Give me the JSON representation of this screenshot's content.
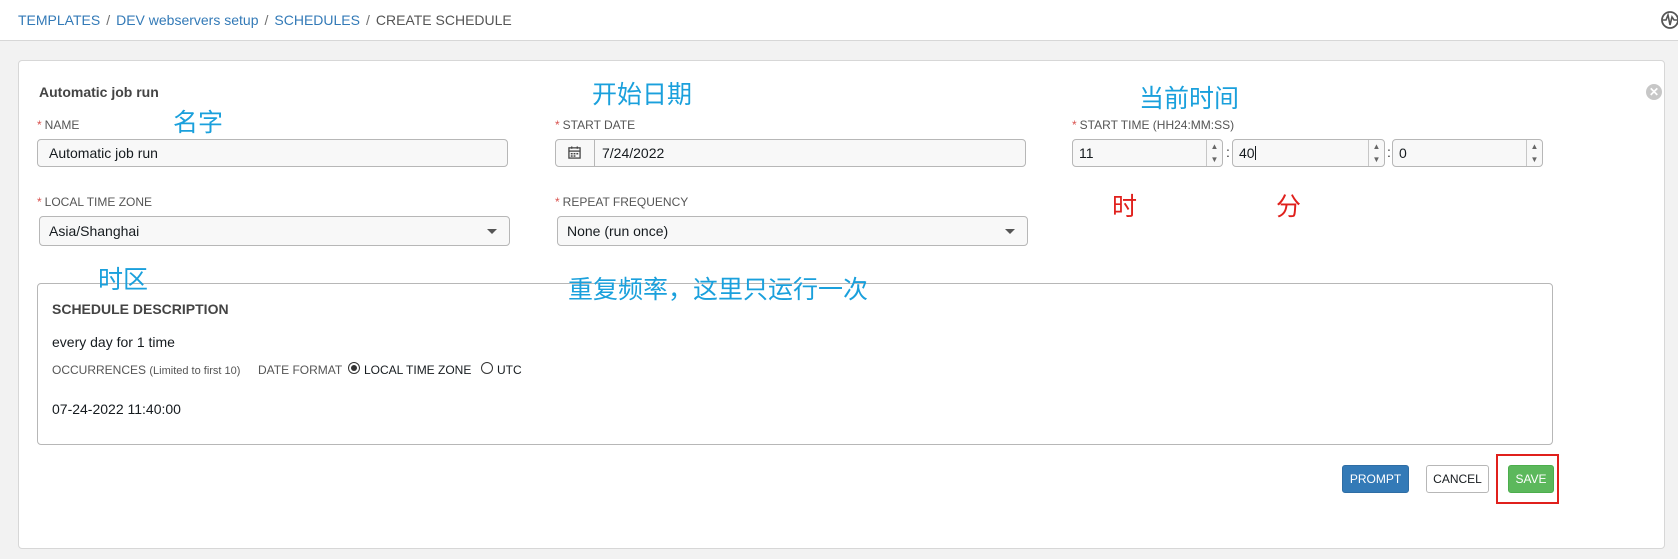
{
  "breadcrumb": {
    "items": [
      "TEMPLATES",
      "DEV webservers setup",
      "SCHEDULES"
    ],
    "current": "CREATE SCHEDULE"
  },
  "form": {
    "title": "Automatic job run",
    "name_label": "NAME",
    "name_value": "Automatic job run",
    "start_date_label": "START DATE",
    "start_date_value": "7/24/2022",
    "start_time_label": "START TIME (HH24:MM:SS)",
    "time": {
      "hour": "11",
      "minute": "40",
      "second": "0"
    },
    "timezone_label": "LOCAL TIME ZONE",
    "timezone_value": "Asia/Shanghai",
    "repeat_label": "REPEAT FREQUENCY",
    "repeat_value": "None (run once)"
  },
  "description": {
    "title": "SCHEDULE DESCRIPTION",
    "text": "every day for 1 time",
    "occurrences_label": "OCCURRENCES",
    "occurrences_limit": "(Limited to first 10)",
    "date_format_label": "DATE FORMAT",
    "format_options": [
      "LOCAL TIME ZONE",
      "UTC"
    ],
    "selected_format": "LOCAL TIME ZONE",
    "occurrence": "07-24-2022 11:40:00"
  },
  "buttons": {
    "prompt": "PROMPT",
    "cancel": "CANCEL",
    "save": "SAVE"
  },
  "annotations": {
    "name": "名字",
    "start_date": "开始日期",
    "current_time": "当前时间",
    "hour": "时",
    "minute": "分",
    "timezone": "时区",
    "repeat": "重复频率，这里只运行一次"
  },
  "colors": {
    "link": "#337ab7",
    "required": "#d9534f",
    "prompt": "#337ab7",
    "save": "#5cb85c",
    "annotation_blue": "#1aa0dc",
    "annotation_red": "#e0201c"
  },
  "icons": [
    "calendar-icon",
    "close-icon",
    "activity-stream-icon",
    "caret-down-icon"
  ]
}
